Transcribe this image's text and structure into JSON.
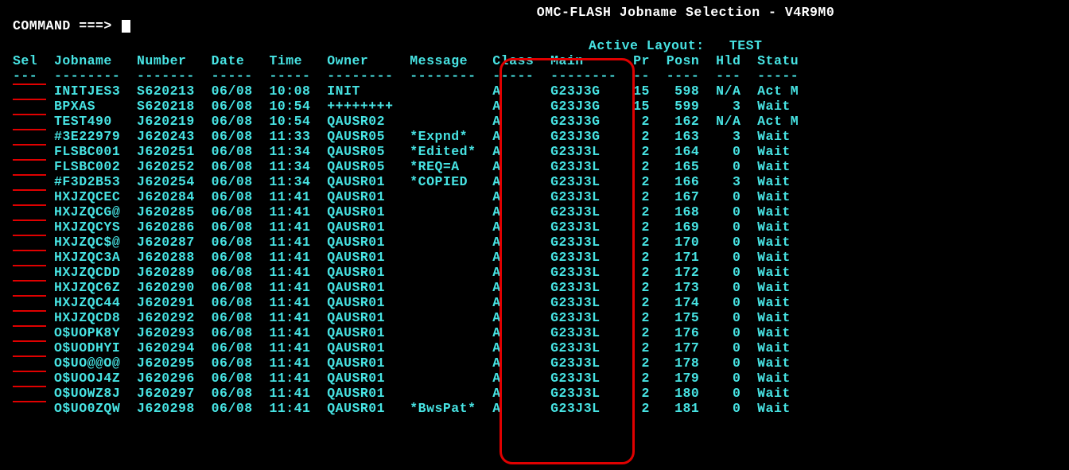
{
  "header": {
    "title": "OMC-FLASH Jobname Selection - V4R9M0",
    "command_label": "COMMAND ===>",
    "active_layout_label": "Active Layout:",
    "active_layout_value": "TEST"
  },
  "columns": {
    "sel": {
      "label": "Sel",
      "dash": "---"
    },
    "jobname": {
      "label": "Jobname",
      "dash": "--------"
    },
    "number": {
      "label": "Number",
      "dash": "-------"
    },
    "date": {
      "label": "Date",
      "dash": "-----"
    },
    "time": {
      "label": "Time",
      "dash": "-----"
    },
    "owner": {
      "label": "Owner",
      "dash": "--------"
    },
    "message": {
      "label": "Message",
      "dash": "--------"
    },
    "class": {
      "label": "Class",
      "dash": "-----"
    },
    "main": {
      "label": "Main",
      "dash": "--------"
    },
    "pr": {
      "label": "Pr",
      "dash": "--"
    },
    "posn": {
      "label": "Posn",
      "dash": "----"
    },
    "hld": {
      "label": "Hld",
      "dash": "---"
    },
    "status": {
      "label": "Statu",
      "dash": "-----"
    }
  },
  "rows": [
    {
      "jobname": "INITJES3",
      "number": "S620213",
      "date": "06/08",
      "time": "10:08",
      "owner": "INIT",
      "message": "",
      "class": "A",
      "main": "G23J3G",
      "pr": "15",
      "posn": "598",
      "hld": "N/A",
      "status": "Act M"
    },
    {
      "jobname": "BPXAS",
      "number": "S620218",
      "date": "06/08",
      "time": "10:54",
      "owner": "++++++++",
      "message": "",
      "class": "A",
      "main": "G23J3G",
      "pr": "15",
      "posn": "599",
      "hld": "3",
      "status": "Wait"
    },
    {
      "jobname": "TEST490",
      "number": "J620219",
      "date": "06/08",
      "time": "10:54",
      "owner": "QAUSR02",
      "message": "",
      "class": "A",
      "main": "G23J3G",
      "pr": "2",
      "posn": "162",
      "hld": "N/A",
      "status": "Act M"
    },
    {
      "jobname": "#3E22979",
      "number": "J620243",
      "date": "06/08",
      "time": "11:33",
      "owner": "QAUSR05",
      "message": "*Expnd*",
      "class": "A",
      "main": "G23J3G",
      "pr": "2",
      "posn": "163",
      "hld": "3",
      "status": "Wait"
    },
    {
      "jobname": "FLSBC001",
      "number": "J620251",
      "date": "06/08",
      "time": "11:34",
      "owner": "QAUSR05",
      "message": "*Edited*",
      "class": "A",
      "main": "G23J3L",
      "pr": "2",
      "posn": "164",
      "hld": "0",
      "status": "Wait"
    },
    {
      "jobname": "FLSBC002",
      "number": "J620252",
      "date": "06/08",
      "time": "11:34",
      "owner": "QAUSR05",
      "message": "*REQ=A",
      "class": "A",
      "main": "G23J3L",
      "pr": "2",
      "posn": "165",
      "hld": "0",
      "status": "Wait"
    },
    {
      "jobname": "#F3D2B53",
      "number": "J620254",
      "date": "06/08",
      "time": "11:34",
      "owner": "QAUSR01",
      "message": "*COPIED",
      "class": "A",
      "main": "G23J3L",
      "pr": "2",
      "posn": "166",
      "hld": "3",
      "status": "Wait"
    },
    {
      "jobname": "HXJZQCEC",
      "number": "J620284",
      "date": "06/08",
      "time": "11:41",
      "owner": "QAUSR01",
      "message": "",
      "class": "A",
      "main": "G23J3L",
      "pr": "2",
      "posn": "167",
      "hld": "0",
      "status": "Wait"
    },
    {
      "jobname": "HXJZQCG@",
      "number": "J620285",
      "date": "06/08",
      "time": "11:41",
      "owner": "QAUSR01",
      "message": "",
      "class": "A",
      "main": "G23J3L",
      "pr": "2",
      "posn": "168",
      "hld": "0",
      "status": "Wait"
    },
    {
      "jobname": "HXJZQCYS",
      "number": "J620286",
      "date": "06/08",
      "time": "11:41",
      "owner": "QAUSR01",
      "message": "",
      "class": "A",
      "main": "G23J3L",
      "pr": "2",
      "posn": "169",
      "hld": "0",
      "status": "Wait"
    },
    {
      "jobname": "HXJZQC$@",
      "number": "J620287",
      "date": "06/08",
      "time": "11:41",
      "owner": "QAUSR01",
      "message": "",
      "class": "A",
      "main": "G23J3L",
      "pr": "2",
      "posn": "170",
      "hld": "0",
      "status": "Wait"
    },
    {
      "jobname": "HXJZQC3A",
      "number": "J620288",
      "date": "06/08",
      "time": "11:41",
      "owner": "QAUSR01",
      "message": "",
      "class": "A",
      "main": "G23J3L",
      "pr": "2",
      "posn": "171",
      "hld": "0",
      "status": "Wait"
    },
    {
      "jobname": "HXJZQCDD",
      "number": "J620289",
      "date": "06/08",
      "time": "11:41",
      "owner": "QAUSR01",
      "message": "",
      "class": "A",
      "main": "G23J3L",
      "pr": "2",
      "posn": "172",
      "hld": "0",
      "status": "Wait"
    },
    {
      "jobname": "HXJZQC6Z",
      "number": "J620290",
      "date": "06/08",
      "time": "11:41",
      "owner": "QAUSR01",
      "message": "",
      "class": "A",
      "main": "G23J3L",
      "pr": "2",
      "posn": "173",
      "hld": "0",
      "status": "Wait"
    },
    {
      "jobname": "HXJZQC44",
      "number": "J620291",
      "date": "06/08",
      "time": "11:41",
      "owner": "QAUSR01",
      "message": "",
      "class": "A",
      "main": "G23J3L",
      "pr": "2",
      "posn": "174",
      "hld": "0",
      "status": "Wait"
    },
    {
      "jobname": "HXJZQCD8",
      "number": "J620292",
      "date": "06/08",
      "time": "11:41",
      "owner": "QAUSR01",
      "message": "",
      "class": "A",
      "main": "G23J3L",
      "pr": "2",
      "posn": "175",
      "hld": "0",
      "status": "Wait"
    },
    {
      "jobname": "O$UOPK8Y",
      "number": "J620293",
      "date": "06/08",
      "time": "11:41",
      "owner": "QAUSR01",
      "message": "",
      "class": "A",
      "main": "G23J3L",
      "pr": "2",
      "posn": "176",
      "hld": "0",
      "status": "Wait"
    },
    {
      "jobname": "O$UODHYI",
      "number": "J620294",
      "date": "06/08",
      "time": "11:41",
      "owner": "QAUSR01",
      "message": "",
      "class": "A",
      "main": "G23J3L",
      "pr": "2",
      "posn": "177",
      "hld": "0",
      "status": "Wait"
    },
    {
      "jobname": "O$UO@@O@",
      "number": "J620295",
      "date": "06/08",
      "time": "11:41",
      "owner": "QAUSR01",
      "message": "",
      "class": "A",
      "main": "G23J3L",
      "pr": "2",
      "posn": "178",
      "hld": "0",
      "status": "Wait"
    },
    {
      "jobname": "O$UOOJ4Z",
      "number": "J620296",
      "date": "06/08",
      "time": "11:41",
      "owner": "QAUSR01",
      "message": "",
      "class": "A",
      "main": "G23J3L",
      "pr": "2",
      "posn": "179",
      "hld": "0",
      "status": "Wait"
    },
    {
      "jobname": "O$UOWZ8J",
      "number": "J620297",
      "date": "06/08",
      "time": "11:41",
      "owner": "QAUSR01",
      "message": "",
      "class": "A",
      "main": "G23J3L",
      "pr": "2",
      "posn": "180",
      "hld": "0",
      "status": "Wait"
    },
    {
      "jobname": "O$UO0ZQW",
      "number": "J620298",
      "date": "06/08",
      "time": "11:41",
      "owner": "QAUSR01",
      "message": "*BwsPat*",
      "class": "A",
      "main": "G23J3L",
      "pr": "2",
      "posn": "181",
      "hld": "0",
      "status": "Wait"
    }
  ]
}
